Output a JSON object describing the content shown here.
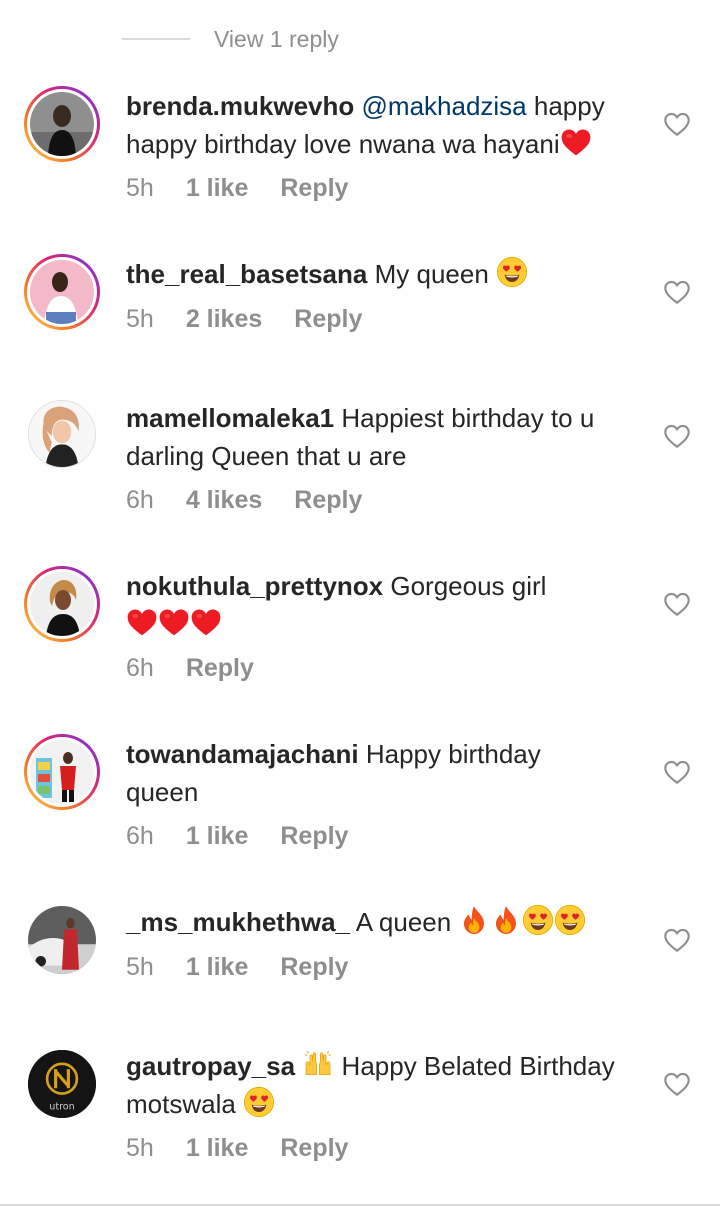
{
  "view_replies": {
    "label": "View 1 reply"
  },
  "icons": {
    "like": "heart-outline-icon",
    "red_heart": "red-heart-emoji",
    "heart_eyes": "heart-eyes-emoji",
    "fire": "fire-emoji",
    "raised_hands": "raising-hands-emoji"
  },
  "colors": {
    "secondary_text": "#8e8e8e",
    "mention": "#00376b",
    "heart_red": "#ed1c24"
  },
  "comments": [
    {
      "username": "brenda.mukwevho",
      "mention": "@makhadzisa",
      "text_line1": "happy",
      "text_line2": "happy birthday love nwana wa hayani",
      "time": "5h",
      "likes": "1 like",
      "reply": "Reply"
    },
    {
      "username": "the_real_basetsana",
      "text": "My queen",
      "time": "5h",
      "likes": "2 likes",
      "reply": "Reply"
    },
    {
      "username": "mamellomaleka1",
      "text_line1": "Happiest birthday to u",
      "text_line2": "darling Queen that u are",
      "time": "6h",
      "likes": "4 likes",
      "reply": "Reply"
    },
    {
      "username": "nokuthula_prettynox",
      "text": "Gorgeous girl",
      "time": "6h",
      "reply": "Reply"
    },
    {
      "username": "towandamajachani",
      "text_line1": "Happy birthday",
      "text_line2": "queen",
      "time": "6h",
      "likes": "1 like",
      "reply": "Reply"
    },
    {
      "username": "_ms_mukhethwa_",
      "text": "A queen",
      "time": "5h",
      "likes": "1 like",
      "reply": "Reply"
    },
    {
      "username": "gautropay_sa",
      "text_line1": "Happy Belated Birthday",
      "text_line2": "motswala",
      "time": "5h",
      "likes": "1 like",
      "reply": "Reply",
      "avatar_logo_text": "utron"
    }
  ]
}
